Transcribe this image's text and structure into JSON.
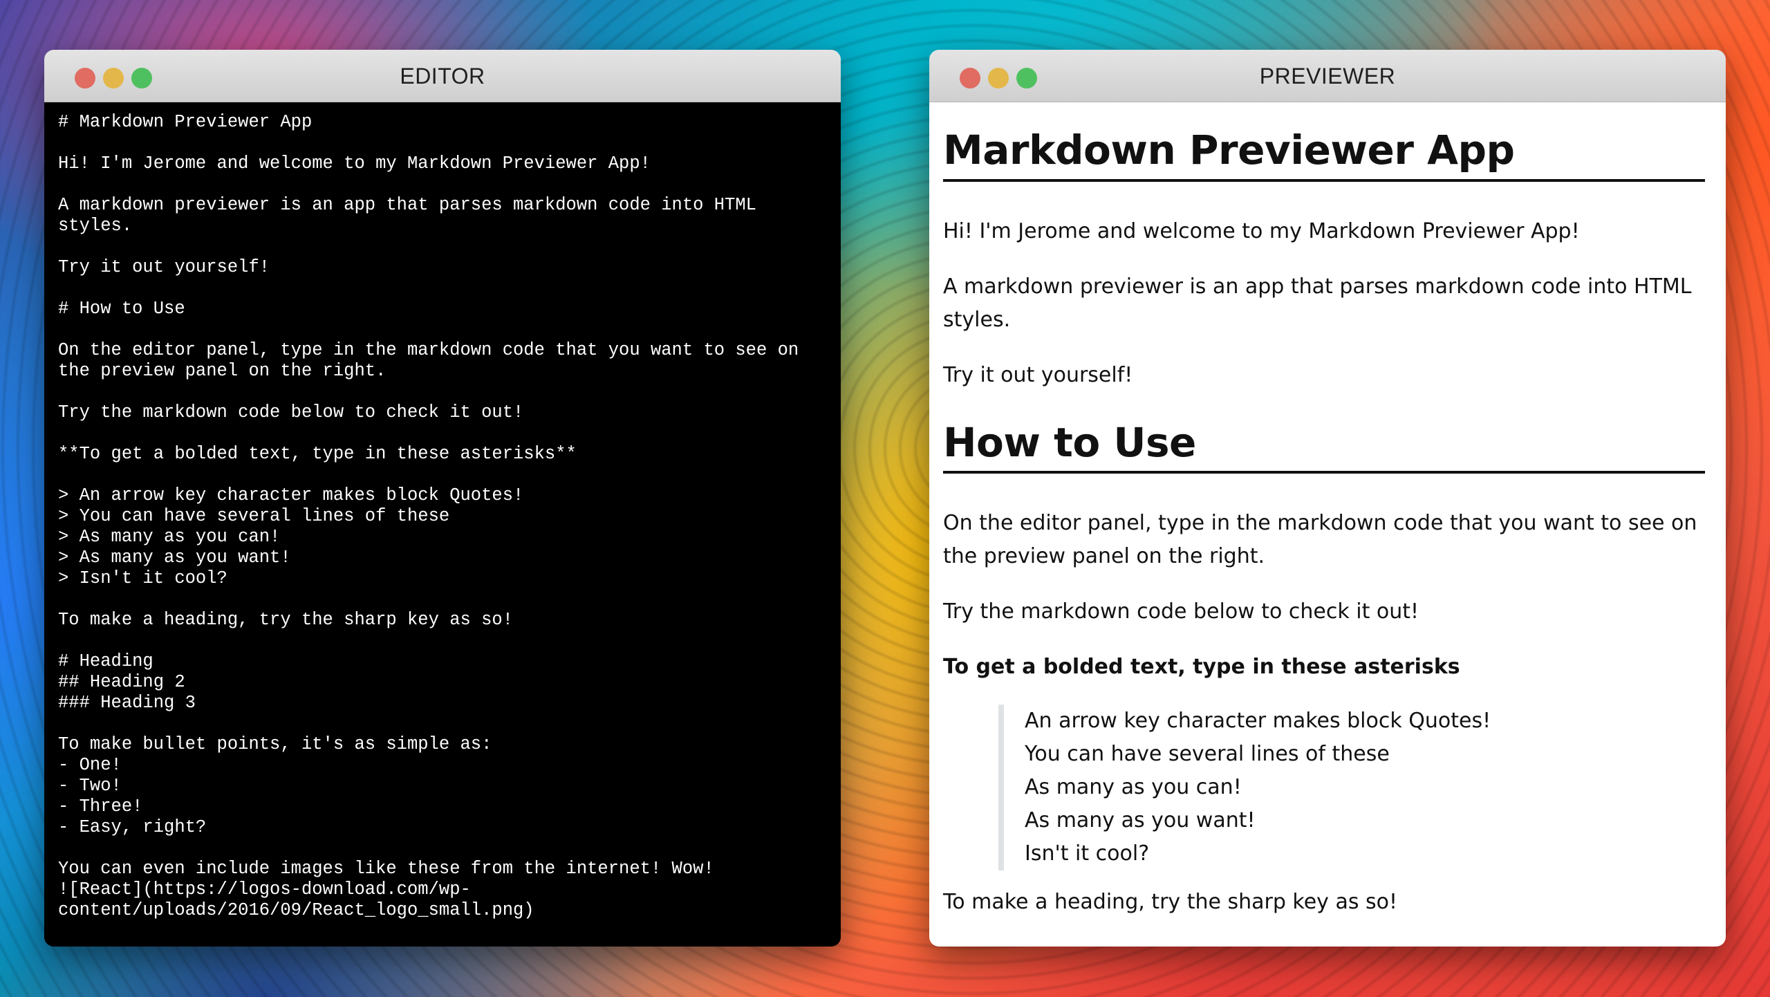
{
  "editor": {
    "title": "EDITOR",
    "content": "# Markdown Previewer App\n\nHi! I'm Jerome and welcome to my Markdown Previewer App!\n\nA markdown previewer is an app that parses markdown code into HTML styles.\n\nTry it out yourself!\n\n# How to Use\n\nOn the editor panel, type in the markdown code that you want to see on the preview panel on the right.\n\nTry the markdown code below to check it out!\n\n**To get a bolded text, type in these asterisks**\n\n> An arrow key character makes block Quotes!\n> You can have several lines of these\n> As many as you can!\n> As many as you want!\n> Isn't it cool?\n\nTo make a heading, try the sharp key as so!\n\n# Heading\n## Heading 2\n### Heading 3\n\nTo make bullet points, it's as simple as:\n- One!\n- Two!\n- Three!\n- Easy, right?\n\nYou can even include images like these from the internet! Wow!\n![React](https://logos-download.com/wp-content/uploads/2016/09/React_logo_small.png)"
  },
  "previewer": {
    "title": "PREVIEWER",
    "heading1": "Markdown Previewer App",
    "intro": "Hi! I'm Jerome and welcome to my Markdown Previewer App!",
    "description": "A markdown previewer is an app that parses markdown code into HTML styles.",
    "try_it": "Try it out yourself!",
    "heading2": "How to Use",
    "instructions": "On the editor panel, type in the markdown code that you want to see on the preview panel on the right.",
    "try_code": "Try the markdown code below to check it out!",
    "bold_text": "To get a bolded text, type in these asterisks",
    "quote_lines": [
      "An arrow key character makes block Quotes!",
      "You can have several lines of these",
      "As many as you can!",
      "As many as you want!",
      "Isn't it cool?"
    ],
    "heading_tip": "To make a heading, try the sharp key as so!"
  },
  "window_controls": {
    "close": "close",
    "minimize": "minimize",
    "maximize": "maximize"
  }
}
